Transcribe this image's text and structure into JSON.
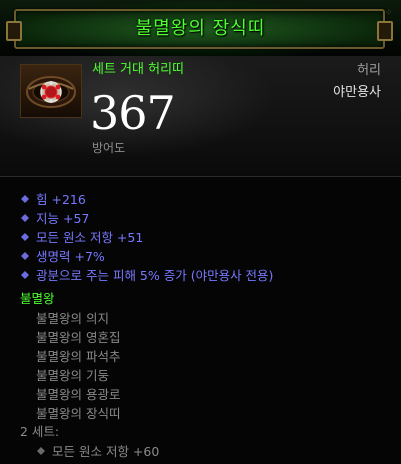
{
  "item": {
    "name": "불멸왕의 장식띠",
    "type": "세트 거대 허리띠",
    "slot": "허리",
    "class": "야만용사",
    "armor": "367",
    "armor_label": "방어도"
  },
  "stats": [
    {
      "text": "힘 +216"
    },
    {
      "text": "지능 +57"
    },
    {
      "text": "모든 원소 저항 +51"
    },
    {
      "text": "생명력 +7%"
    },
    {
      "text": "광분으로 주는 피해 5% 증가 (야만용사 전용)"
    }
  ],
  "set": {
    "name": "불멸왕",
    "pieces": [
      "불멸왕의 의지",
      "불멸왕의 영혼집",
      "불멸왕의 파석추",
      "불멸왕의 기둥",
      "불멸왕의 용광로",
      "불멸왕의 장식띠"
    ],
    "bonus_label": "2 세트:",
    "bonus_stat": "모든 원소 저항 +60"
  },
  "colors": {
    "set_green": "#4dff2f",
    "magic_blue": "#7878ff",
    "inactive_gray": "#8a8a8a",
    "armor_white": "#ffffff"
  },
  "icons": {
    "item_icon": "belt-icon",
    "bullet": "diamond-bullet-icon"
  }
}
